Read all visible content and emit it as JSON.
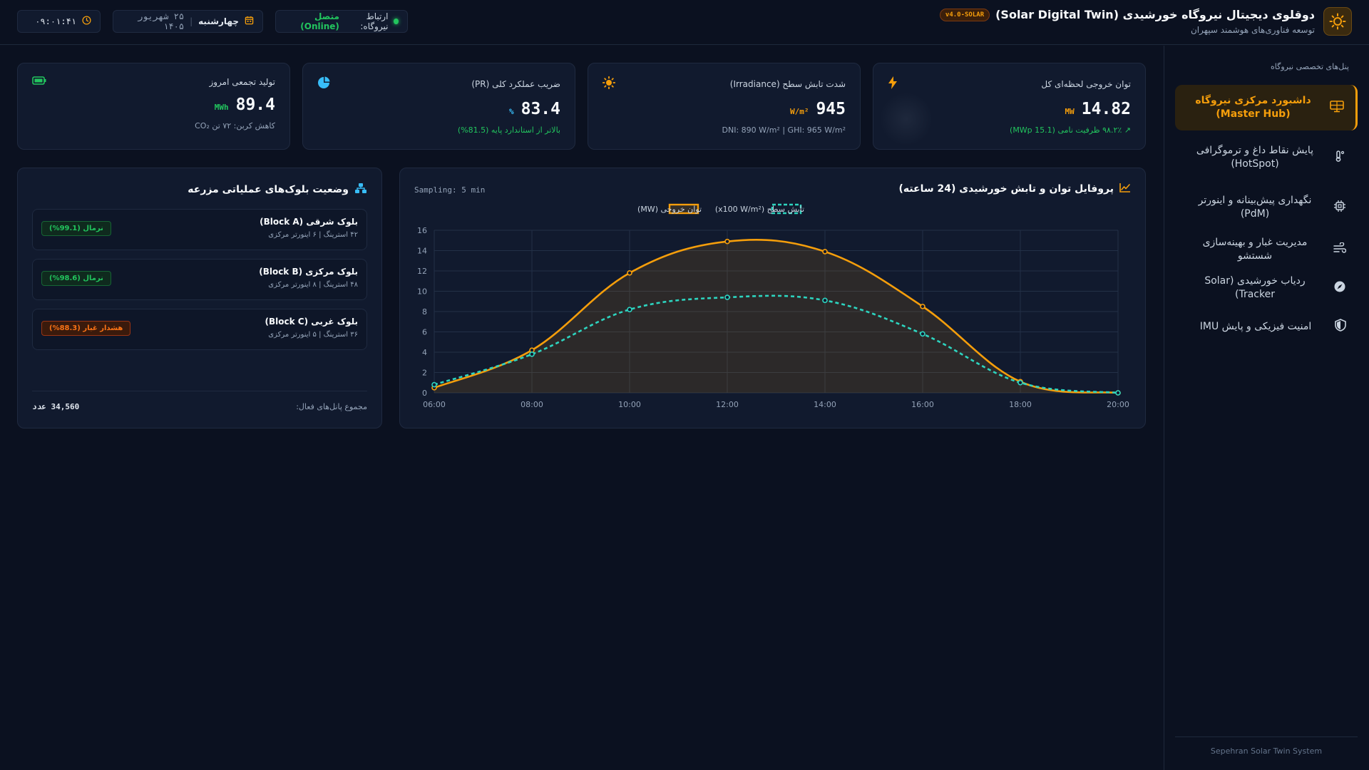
{
  "header": {
    "title": "دوقلوی دیجیتال نیروگاه خورشیدی (Solar Digital Twin)",
    "version": "v4.0-SOLAR",
    "subtitle": "توسعه فناوری‌های هوشمند سپهران",
    "connection_label": "ارتباط نیروگاه:",
    "connection_value": "متصل (Online)",
    "day": "چهارشنبه",
    "date": "۲۵ شهریور ۱۴۰۵",
    "time": "۰۹:۰۱:۴۱",
    "progress_fraction": 0.2
  },
  "sidebar": {
    "heading": "پنل‌های تخصصی نیروگاه",
    "items": [
      {
        "label": "داشبورد مرکزی نیروگاه (Master Hub)",
        "icon": "dashboard-icon",
        "active": true
      },
      {
        "label": "پایش نقاط داغ و ترموگرافی (HotSpot)",
        "icon": "thermometer-icon"
      },
      {
        "label": "نگهداری پیش‌بینانه و اینورتر (PdM)",
        "icon": "chip-icon"
      },
      {
        "label": "مدیریت غبار و بهینه‌سازی شستشو",
        "icon": "wind-icon"
      },
      {
        "label": "ردیاب خورشیدی (Solar Tracker)",
        "icon": "compass-icon"
      },
      {
        "label": "امنیت فیزیکی و پایش IMU",
        "icon": "shield-icon"
      }
    ],
    "footer": "Sepehran Solar Twin System"
  },
  "kpis": [
    {
      "title": "توان خروجی لحظه‌ای کل",
      "value": "14.82",
      "unit": "MW",
      "foot": "۹۸.۲٪ ظرفیت نامی (15.1 MWp)",
      "foot_color": "green",
      "icon": "bolt-icon",
      "accent": "#f59e0b"
    },
    {
      "title": "شدت تابش سطح (Irradiance)",
      "value": "945",
      "unit": "W/m²",
      "foot": "DNI: 890 W/m² | GHI: 965 W/m²",
      "foot_color": "gray",
      "icon": "sun-icon",
      "accent": "#f59e0b"
    },
    {
      "title": "ضریب عملکرد کلی (PR)",
      "value": "83.4",
      "unit": "%",
      "foot": "بالاتر از استاندارد پایه (81.5%)",
      "foot_color": "green",
      "icon": "pie-icon",
      "accent": "#38bdf8"
    },
    {
      "title": "تولید تجمعی امروز",
      "value": "89.4",
      "unit": "MWh",
      "foot": "کاهش کربن: ۷۲ تن CO₂",
      "foot_color": "gray",
      "icon": "battery-icon",
      "accent": "#22c55e"
    }
  ],
  "chart_panel": {
    "title": "پروفایل توان و تابش خورشیدی (24 ساعته)",
    "sampling": "Sampling: 5 min"
  },
  "chart_data": {
    "type": "line",
    "x": [
      "06:00",
      "08:00",
      "10:00",
      "12:00",
      "14:00",
      "16:00",
      "18:00",
      "20:00"
    ],
    "series": [
      {
        "name": "توان خروجی (MW)",
        "values": [
          0.5,
          4.2,
          11.8,
          14.9,
          13.9,
          8.5,
          1.1,
          0.0
        ],
        "color": "#f59e0b",
        "style": "solid",
        "fill": true
      },
      {
        "name": "تابش سطح (x100 W/m²)",
        "values": [
          0.8,
          3.8,
          8.2,
          9.4,
          9.1,
          5.8,
          1.0,
          0.0
        ],
        "color": "#2dd4bf",
        "style": "dashed",
        "fill": false
      }
    ],
    "ylim": [
      0,
      16
    ],
    "yticks": [
      0,
      2,
      4,
      6,
      8,
      10,
      12,
      14,
      16
    ],
    "grid": true,
    "legend_position": "top-center"
  },
  "blocks_panel": {
    "title": "وضعیت بلوک‌های عملیاتی مزرعه",
    "blocks": [
      {
        "name": "بلوک شرقی (Block A)",
        "meta": "۴۲ استرینگ | ۶ اینورتر مرکزی",
        "badge": "نرمال (99.1%)",
        "status": "ok"
      },
      {
        "name": "بلوک مرکزی (Block B)",
        "meta": "۴۸ استرینگ | ۸ اینورتر مرکزی",
        "badge": "نرمال (98.6%)",
        "status": "ok"
      },
      {
        "name": "بلوک غربی (Block C)",
        "meta": "۳۶ استرینگ | ۵ اینورتر مرکزی",
        "badge": "هشدار غبار (88.3%)",
        "status": "warn"
      }
    ],
    "total_label": "مجموع پانل‌های فعال:",
    "total_value": "34,560 عدد"
  }
}
